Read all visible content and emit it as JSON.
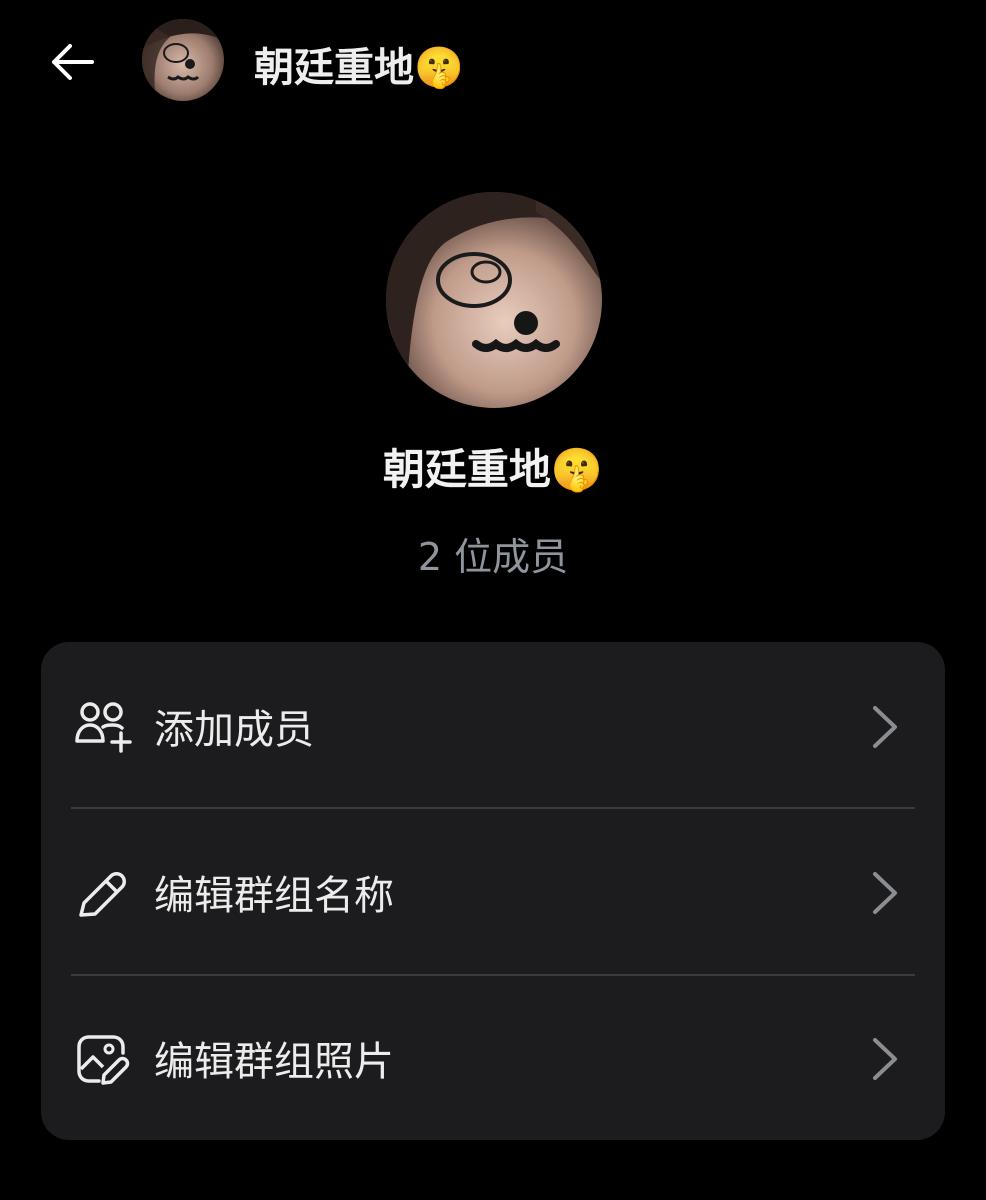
{
  "header": {
    "title": "朝廷重地🤫"
  },
  "profile": {
    "name": "朝廷重地🤫",
    "member_count": "2 位成员"
  },
  "options": [
    {
      "label": "添加成员",
      "icon": "add-people-icon"
    },
    {
      "label": "编辑群组名称",
      "icon": "pencil-icon"
    },
    {
      "label": "编辑群组照片",
      "icon": "edit-photo-icon"
    }
  ],
  "colors": {
    "background": "#000000",
    "card": "#1c1c1e",
    "divider": "#3a3b3e",
    "subtitle": "#8e959d",
    "chevron": "#8a8d92"
  }
}
